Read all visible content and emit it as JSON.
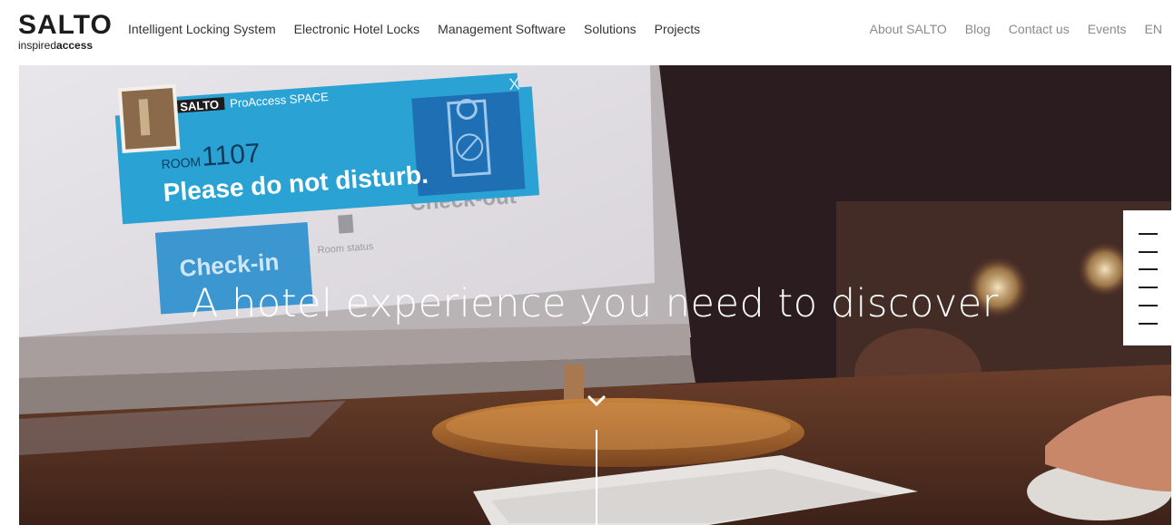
{
  "brand": {
    "name": "SALTO",
    "tagline_light": "inspired",
    "tagline_bold": "access"
  },
  "nav_main": [
    {
      "label": "Intelligent Locking System"
    },
    {
      "label": "Electronic Hotel Locks"
    },
    {
      "label": "Management Software"
    },
    {
      "label": "Solutions"
    },
    {
      "label": "Projects"
    }
  ],
  "nav_util": [
    {
      "label": "About SALTO"
    },
    {
      "label": "Blog"
    },
    {
      "label": "Contact us"
    },
    {
      "label": "Events"
    },
    {
      "label": "EN"
    }
  ],
  "hero": {
    "title": "A hotel experience you need to discover",
    "screen": {
      "app_brand": "SALTO",
      "app_name": "ProAccess SPACE",
      "room_label": "ROOM",
      "room_number": "1107",
      "message": "Please do not disturb.",
      "checkin_label": "Check-in",
      "checkout_label": "Check-out",
      "room_status_label": "Room status",
      "close_glyph": "X"
    },
    "icons": [
      "door-hanger-icon",
      "close-icon",
      "chevron-down-icon"
    ]
  },
  "colors": {
    "accent_cyan": "#2aa3d4",
    "accent_blue": "#1f6fb5",
    "text_dark": "#1c1c1c",
    "nav_util": "#8a8a8a"
  }
}
